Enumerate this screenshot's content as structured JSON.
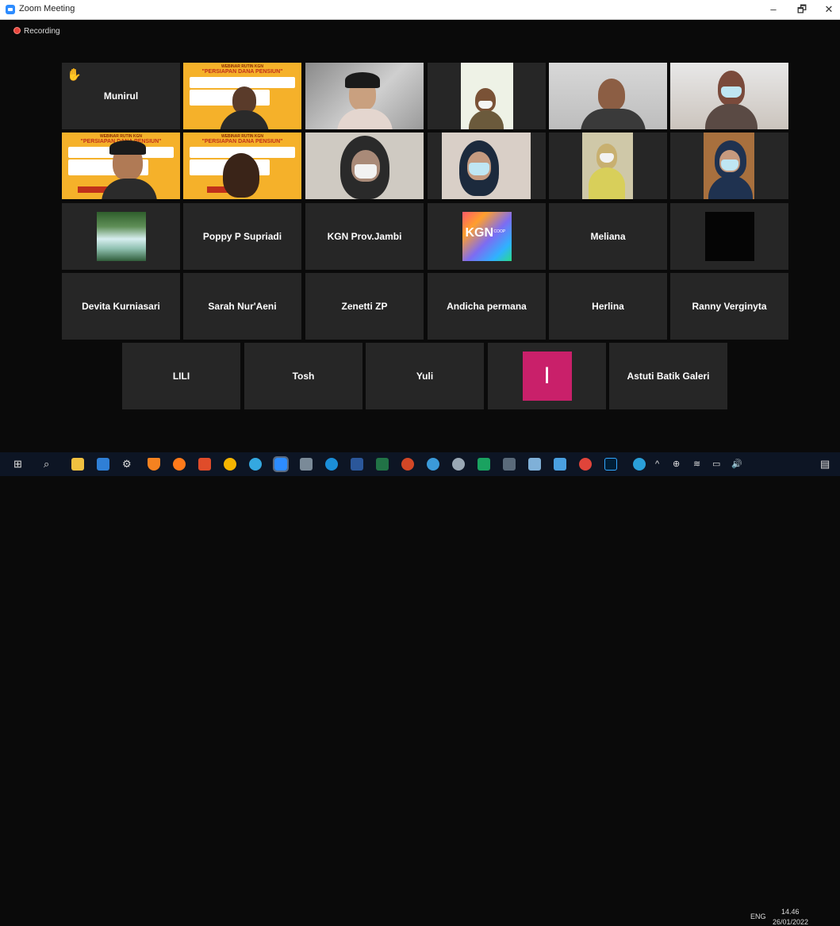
{
  "window": {
    "title": "Zoom Meeting",
    "minimize": "–",
    "restore": "🗗",
    "close": "✕"
  },
  "recording": {
    "label": "Recording"
  },
  "participants": {
    "munirul": "Munirul",
    "poppy": "Poppy P Supriadi",
    "kgn": "KGN Prov.Jambi",
    "meliana": "Meliana",
    "devita": "Devita Kurniasari",
    "sarah": "Sarah Nur'Aeni",
    "zenetti": "Zenetti ZP",
    "andicha": "Andicha permana",
    "herlina": "Herlina",
    "ranny": "Ranny Verginyta",
    "lili": "LILI",
    "tosh": "Tosh",
    "yuli": "Yuli",
    "astuti": "Astuti Batik Galeri"
  },
  "tiles": {
    "yuli_initial": "I",
    "kgn_logo": "KGN",
    "kgn_logo_sub": "COOP",
    "webinar_small": "WEBINAR RUTIN KGN",
    "webinar_title": "\"PERSIAPAN DANA PENSIUN\""
  },
  "taskbar": {
    "time": "14.46",
    "date": "26/01/2022",
    "lang": "ENG"
  },
  "colors": {
    "accent": "#2d8cff",
    "active_speaker": "#f0d000",
    "recording": "#e8453c",
    "initial_box": "#c9206a"
  }
}
